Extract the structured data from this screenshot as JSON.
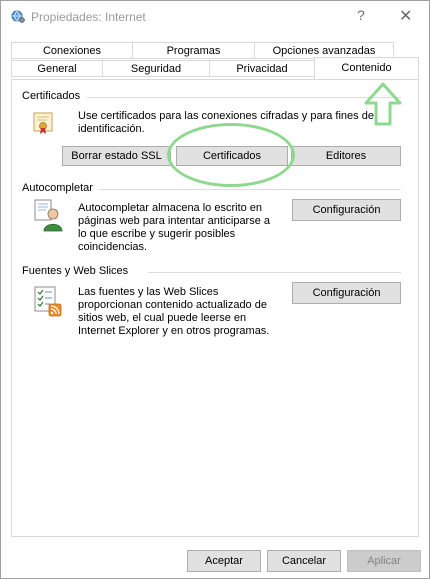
{
  "window": {
    "title": "Propiedades: Internet",
    "help_glyph": "?",
    "close_glyph": "✕"
  },
  "tabs": {
    "row1": [
      "Conexiones",
      "Programas",
      "Opciones avanzadas"
    ],
    "row2": [
      "General",
      "Seguridad",
      "Privacidad",
      "Contenido"
    ],
    "active": "Contenido"
  },
  "certificados": {
    "title": "Certificados",
    "description_line1": "Use certificados para las conexiones cifradas y para fines de",
    "description_line2": "identificación.",
    "buttons": [
      "Borrar estado SSL",
      "Certificados",
      "Editores"
    ]
  },
  "autocompletar": {
    "title": "Autocompletar",
    "desc": [
      "Autocompletar almacena lo escrito en",
      "páginas web para intentar anticiparse a",
      "lo que escribe y sugerir posibles",
      "coincidencias."
    ],
    "button": "Configuración"
  },
  "fuentes": {
    "title": "Fuentes y Web Slices",
    "desc": [
      "Las fuentes y las Web Slices",
      "proporcionan contenido actualizado de",
      "sitios web, el cual puede leerse en",
      "Internet Explorer y en otros programas."
    ],
    "button": "Configuración"
  },
  "footer": {
    "ok": "Aceptar",
    "cancel": "Cancelar",
    "apply": "Aplicar"
  },
  "colors": {
    "annotation": "#8fd88f",
    "button_face": "#e1e1e1",
    "button_border": "#adadad"
  },
  "icons": {
    "app": "internet-options-globe-icon",
    "certificate": "certificate-icon",
    "autocomplete": "autocomplete-user-icon",
    "feeds": "feeds-checklist-icon"
  }
}
